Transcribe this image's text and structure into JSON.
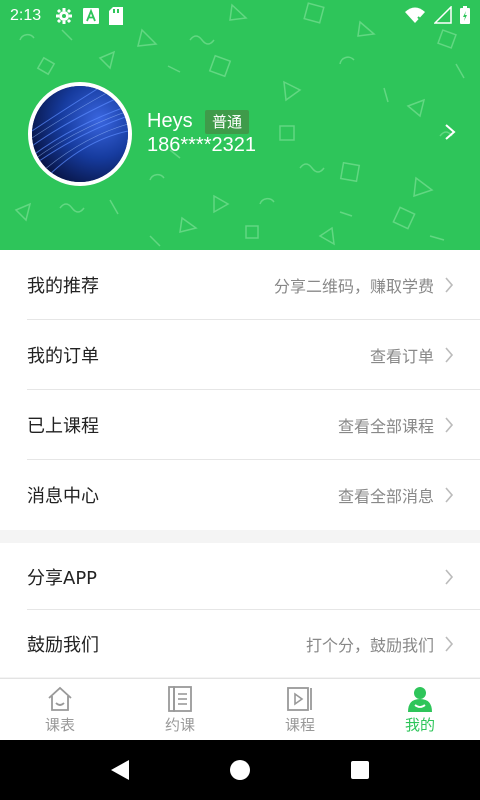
{
  "status_bar": {
    "time": "2:13",
    "icons": [
      "gear-icon",
      "a-notification-icon",
      "sd-card-icon",
      "wifi-icon",
      "signal-icon",
      "battery-icon"
    ]
  },
  "profile": {
    "username": "Heys",
    "badge": "普通",
    "phone": "186****2321"
  },
  "menu": {
    "section1": [
      {
        "label": "我的推荐",
        "hint": "分享二维码，赚取学费"
      },
      {
        "label": "我的订单",
        "hint": "查看订单"
      },
      {
        "label": "已上课程",
        "hint": "查看全部课程"
      },
      {
        "label": "消息中心",
        "hint": "查看全部消息"
      }
    ],
    "section2": [
      {
        "label": "分享APP",
        "hint": ""
      },
      {
        "label": "鼓励我们",
        "hint": "打个分，鼓励我们"
      }
    ]
  },
  "tabs": [
    {
      "label": "课表",
      "icon": "home-icon",
      "active": false
    },
    {
      "label": "约课",
      "icon": "book-icon",
      "active": false
    },
    {
      "label": "课程",
      "icon": "video-icon",
      "active": false
    },
    {
      "label": "我的",
      "icon": "profile-icon",
      "active": true
    }
  ],
  "colors": {
    "brand_green": "#2ec55a",
    "badge_green": "#3f9b4a",
    "inactive": "#999999"
  }
}
